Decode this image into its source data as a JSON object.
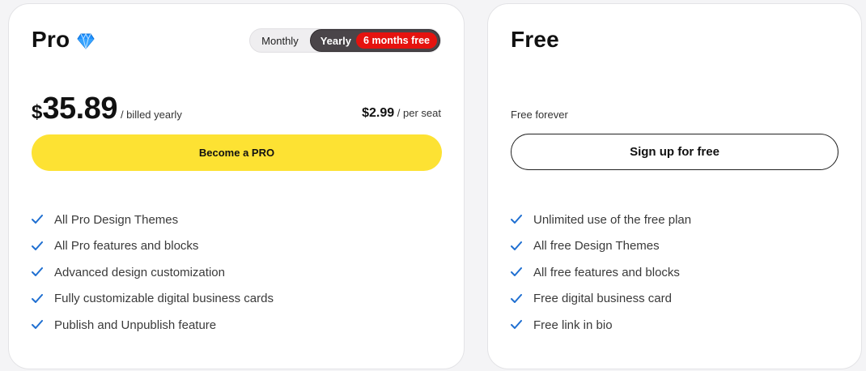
{
  "pro": {
    "title": "Pro",
    "icon": "diamond-gem-icon",
    "toggle": {
      "monthly_label": "Monthly",
      "yearly_label": "Yearly",
      "yearly_badge": "6 months free",
      "selected": "Yearly"
    },
    "price": {
      "currency": "$",
      "amount": "35.89",
      "period": "/ billed yearly"
    },
    "seat": {
      "price": "$2.99",
      "unit": "/ per seat"
    },
    "cta_label": "Become a PRO",
    "features": [
      "All Pro Design Themes",
      "All Pro features and blocks",
      "Advanced design customization",
      "Fully customizable digital business cards",
      "Publish and Unpublish feature"
    ]
  },
  "free": {
    "title": "Free",
    "subtitle": "Free forever",
    "cta_label": "Sign up for free",
    "features": [
      "Unlimited use of the free plan",
      "All free Design Themes",
      "All free features and blocks",
      "Free digital business card",
      "Free link in bio"
    ]
  },
  "colors": {
    "pro_cta": "#fde233",
    "badge_red": "#e5130f",
    "toggle_dark": "#4a4549",
    "check_blue": "#1f6fd1",
    "gem_blue": "#1e90ff"
  }
}
